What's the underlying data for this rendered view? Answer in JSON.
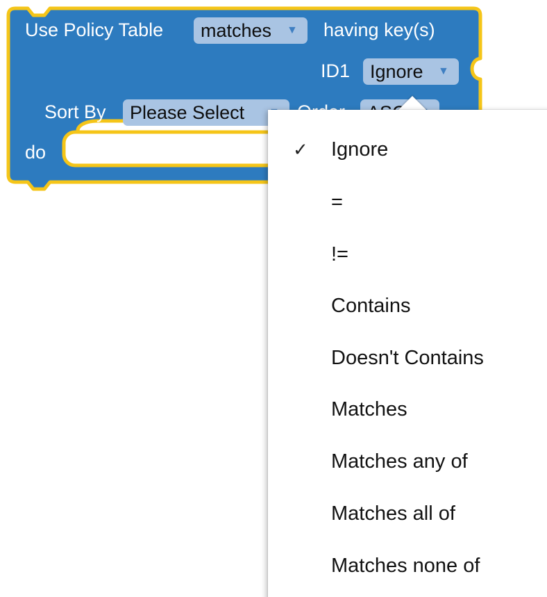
{
  "block": {
    "label_use": "Use Policy Table",
    "table_field": "matches",
    "label_having": "having key(s)",
    "key_label": "ID1",
    "key_field": "Ignore",
    "label_sort": "Sort By",
    "sort_field": "Please Select",
    "label_order": "Order",
    "order_field": "ASC",
    "label_do": "do",
    "colors": {
      "block_fill": "#2d7bbf",
      "selected_outline": "#f5c518",
      "field_fill": "#a9c4e3"
    }
  },
  "menu": {
    "selected": "Ignore",
    "check_glyph": "✓",
    "items": [
      "Ignore",
      "=",
      "!=",
      "Contains",
      "Doesn't Contains",
      "Matches",
      "Matches any of",
      "Matches all of",
      "Matches none of"
    ]
  }
}
